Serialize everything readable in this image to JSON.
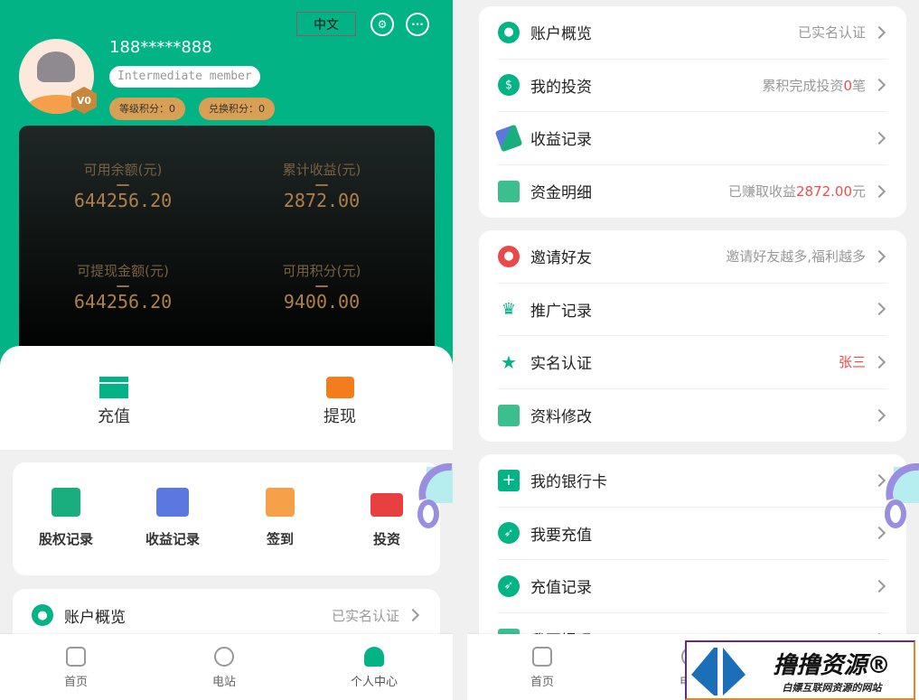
{
  "header": {
    "lang": "中文",
    "phone": "188*****888",
    "member": "Intermediate member",
    "badge": "V0",
    "level_points": "等级积分：0",
    "exchange_points": "兑换积分：0"
  },
  "stats": [
    {
      "label": "可用余额(元)",
      "value": "644256.20"
    },
    {
      "label": "累计收益(元)",
      "value": "2872.00"
    },
    {
      "label": "可提现金额(元)",
      "value": "644256.20"
    },
    {
      "label": "可用积分(元)",
      "value": "9400.00"
    }
  ],
  "actions": [
    {
      "label": "充值",
      "icon": "card-icon"
    },
    {
      "label": "提现",
      "icon": "wallet-icon"
    }
  ],
  "quick": [
    {
      "label": "股权记录",
      "color": "#1aae7e"
    },
    {
      "label": "收益记录",
      "color": "#5a78e0"
    },
    {
      "label": "签到",
      "color": "#f7a04a"
    },
    {
      "label": "投资",
      "color": "#e84040"
    }
  ],
  "menu1": [
    {
      "label": "账户概览",
      "right": "已实名认证",
      "icon": "user-icon"
    },
    {
      "label": "我的投资",
      "right": "累积完成投资",
      "hl": "0",
      "suffix": "笔",
      "icon": "dollar-icon"
    },
    {
      "label": "收益记录",
      "right": "",
      "icon": "handshake-icon"
    },
    {
      "label": "资金明细",
      "right": "已赚取收益",
      "hl": "2872.00",
      "suffix": "元",
      "icon": "briefcase-icon"
    }
  ],
  "menu2": [
    {
      "label": "邀请好友",
      "right": "邀请好友越多,福利越多",
      "icon": "invite-icon"
    },
    {
      "label": "推广记录",
      "right": "",
      "icon": "crown-icon"
    },
    {
      "label": "实名认证",
      "right": "张三",
      "icon": "star-icon"
    },
    {
      "label": "资料修改",
      "right": "",
      "icon": "briefcase-icon"
    }
  ],
  "menu3": [
    {
      "label": "我的银行卡",
      "icon": "plus-icon"
    },
    {
      "label": "我要充值",
      "icon": "compass-icon"
    },
    {
      "label": "充值记录",
      "icon": "compass-icon"
    },
    {
      "label": "我要提现",
      "icon": "cash-icon"
    }
  ],
  "nav": [
    {
      "label": "首页"
    },
    {
      "label": "电站"
    },
    {
      "label": "个人中心"
    }
  ],
  "colors": {
    "primary": "#02b386",
    "gold": "#b08048",
    "highlight": "#f04a4a"
  },
  "watermark": {
    "title": "撸撸资源®",
    "subtitle": "白嫖互联网资源的网站"
  }
}
